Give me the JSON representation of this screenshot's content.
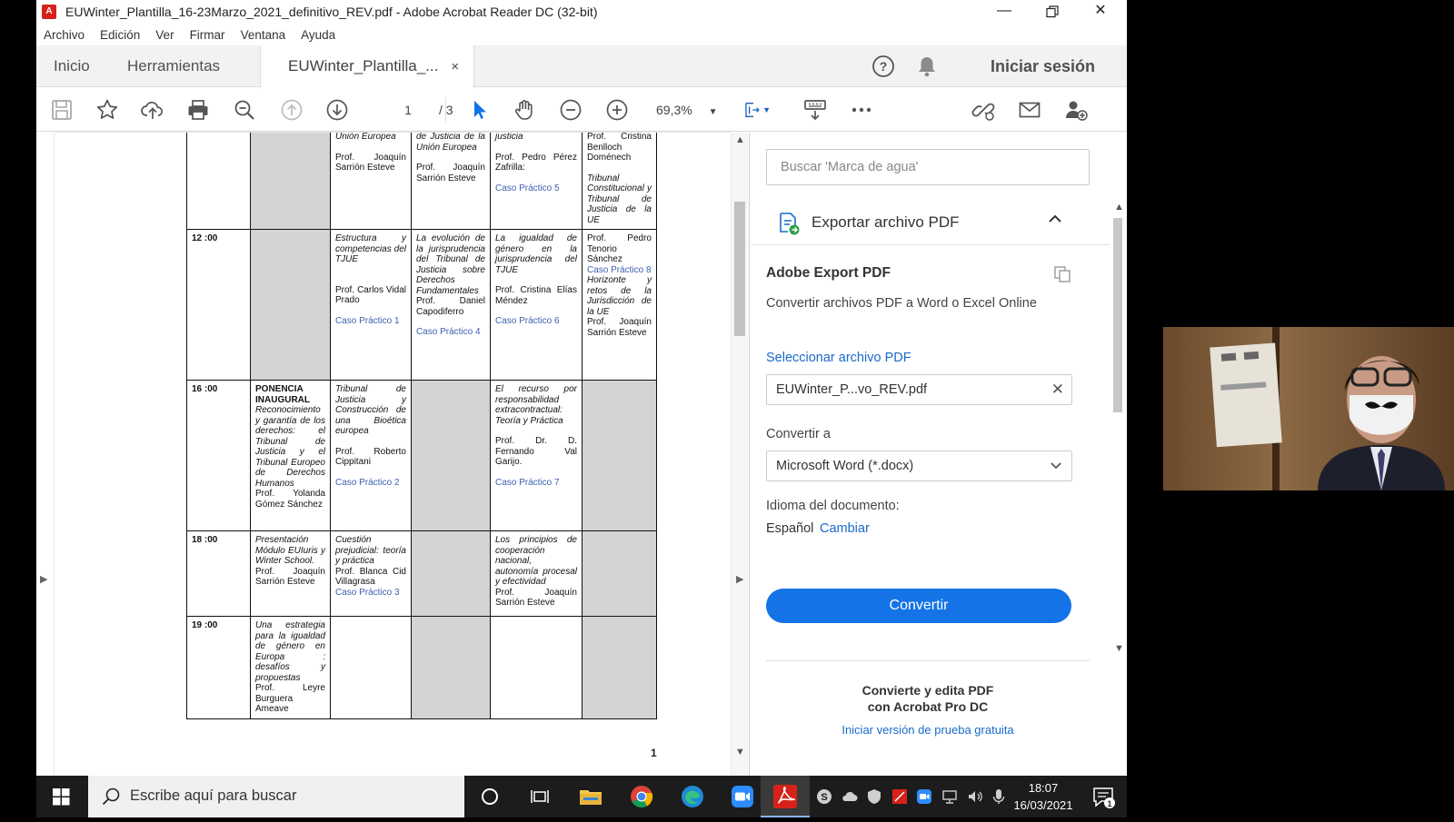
{
  "window": {
    "title": "EUWinter_Plantilla_16-23Marzo_2021_definitivo_REV.pdf - Adobe Acrobat Reader DC (32-bit)",
    "app_icon": "acrobat-icon",
    "controls": [
      "minimize-icon",
      "restore-icon",
      "close-icon"
    ]
  },
  "menu": [
    "Archivo",
    "Edición",
    "Ver",
    "Firmar",
    "Ventana",
    "Ayuda"
  ],
  "tabs": {
    "home": "Inicio",
    "tools": "Herramientas",
    "document": "EUWinter_Plantilla_...",
    "close": "×"
  },
  "header": {
    "sign_in": "Iniciar sesión",
    "help": "?"
  },
  "toolbar": {
    "page_current": "1",
    "page_total": "/ 3",
    "zoom": "69,3%"
  },
  "schedule": {
    "rows": [
      {
        "time": "",
        "cells": [
          {
            "gray": true,
            "lines": []
          },
          {
            "lines": [
              {
                "t": "Unión Europea",
                "s": "i"
              },
              {
                "t": "",
                "s": "i"
              },
              {
                "t": "Prof. Joaquín Sarrión Esteve",
                "s": "p"
              }
            ]
          },
          {
            "lines": [
              {
                "t": "de Justicia de la Unión Europea",
                "s": "i"
              },
              {
                "t": "",
                "s": "i"
              },
              {
                "t": "Prof. Joaquín Sarrión Esteve",
                "s": "p"
              }
            ]
          },
          {
            "lines": [
              {
                "t": "justicia",
                "s": "i"
              },
              {
                "t": "",
                "s": "i"
              },
              {
                "t": "Prof. Pedro Pérez Zafrilla:",
                "s": "p"
              },
              {
                "t": "",
                "s": "i"
              },
              {
                "t": "Caso Práctico 5",
                "s": "c"
              }
            ]
          },
          {
            "lines": [
              {
                "t": "Prof. Cristina Benlloch Doménech",
                "s": "p"
              },
              {
                "t": "",
                "s": "i"
              },
              {
                "t": "Tribunal Constitucional y Tribunal de Justicia de la UE",
                "s": "i"
              }
            ]
          }
        ]
      },
      {
        "time": "12 :00",
        "cells": [
          {
            "gray": true,
            "lines": []
          },
          {
            "lines": [
              {
                "t": "Estructura y competencias del TJUE",
                "s": "i"
              },
              {
                "t": "",
                "s": "i"
              },
              {
                "t": "",
                "s": "i"
              },
              {
                "t": "Prof. Carlos Vidal Prado",
                "s": "p"
              },
              {
                "t": "",
                "s": "i"
              },
              {
                "t": "Caso Práctico 1",
                "s": "c"
              }
            ]
          },
          {
            "lines": [
              {
                "t": "La evolución de la jurisprudencia del Tribunal de Justicia sobre Derechos Fundamentales",
                "s": "i"
              },
              {
                "t": "Prof. Daniel Capodiferro",
                "s": "p"
              },
              {
                "t": "",
                "s": "i"
              },
              {
                "t": "Caso Práctico 4",
                "s": "c"
              }
            ]
          },
          {
            "lines": [
              {
                "t": "La igualdad de género en la jurisprudencia del TJUE",
                "s": "i"
              },
              {
                "t": "",
                "s": "i"
              },
              {
                "t": "Prof. Cristina Elías Méndez",
                "s": "p"
              },
              {
                "t": "",
                "s": "i"
              },
              {
                "t": "Caso Práctico 6",
                "s": "c"
              }
            ]
          },
          {
            "lines": [
              {
                "t": "Prof. Pedro Tenorio Sánchez",
                "s": "p"
              },
              {
                "t": "Caso Práctico 8",
                "s": "c"
              },
              {
                "t": "Horizonte y retos de la Jurisdicción de la UE",
                "s": "i"
              },
              {
                "t": "Prof. Joaquín Sarrión Esteve",
                "s": "p"
              }
            ]
          }
        ]
      },
      {
        "time": "16 :00",
        "cells": [
          {
            "lines": [
              {
                "t": "PONENCIA INAUGURAL",
                "s": "b"
              },
              {
                "t": "Reconocimiento y garantía de los derechos: el Tribunal de Justicia y el Tribunal Europeo de Derechos Humanos",
                "s": "i"
              },
              {
                "t": "Prof. Yolanda Gómez Sánchez",
                "s": "p"
              }
            ]
          },
          {
            "lines": [
              {
                "t": "Tribunal de Justicia y Construcción de una Bioética europea",
                "s": "i"
              },
              {
                "t": "",
                "s": "i"
              },
              {
                "t": "Prof. Roberto Cippitani",
                "s": "p"
              },
              {
                "t": "",
                "s": "i"
              },
              {
                "t": "Caso Práctico 2",
                "s": "c"
              }
            ]
          },
          {
            "gray": true,
            "lines": []
          },
          {
            "lines": [
              {
                "t": "El recurso por responsabilidad extracontractual: Teoría y Práctica",
                "s": "i"
              },
              {
                "t": "",
                "s": "i"
              },
              {
                "t": "Prof. Dr. D. Fernando Val Garijo.",
                "s": "p"
              },
              {
                "t": "",
                "s": "i"
              },
              {
                "t": "Caso Práctico 7",
                "s": "c"
              }
            ]
          },
          {
            "gray": true,
            "lines": []
          }
        ]
      },
      {
        "time": "18 :00",
        "cells": [
          {
            "lines": [
              {
                "t": "Presentación Módulo EUIuris y Winter School.",
                "s": "i"
              },
              {
                "t": "Prof. Joaquín Sarrión Esteve",
                "s": "p"
              }
            ]
          },
          {
            "lines": [
              {
                "t": "Cuestión prejudicial: teoría y práctica",
                "s": "i"
              },
              {
                "t": "Prof. Blanca Cid Villagrasa",
                "s": "p"
              },
              {
                "t": "Caso Práctico 3",
                "s": "c"
              }
            ]
          },
          {
            "gray": true,
            "lines": []
          },
          {
            "lines": [
              {
                "t": "Los principios de cooperación nacional, autonomía procesal y efectividad",
                "s": "i"
              },
              {
                "t": "Prof. Joaquín Sarrión Esteve",
                "s": "p"
              }
            ]
          },
          {
            "gray": true,
            "lines": []
          }
        ]
      },
      {
        "time": "19 :00",
        "cells": [
          {
            "lines": [
              {
                "t": "Una estrategia para la igualdad de género en Europa : desafíos y propuestas",
                "s": "i"
              },
              {
                "t": "Prof. Leyre Burguera Ameave",
                "s": "p"
              }
            ]
          },
          {
            "lines": []
          },
          {
            "gray": true,
            "lines": []
          },
          {
            "lines": []
          },
          {
            "gray": true,
            "lines": []
          }
        ]
      }
    ],
    "page_number": "1"
  },
  "panel": {
    "search_placeholder": "Buscar 'Marca de agua'",
    "export_header": "Exportar archivo PDF",
    "aep_title": "Adobe Export PDF",
    "aep_desc": "Convertir archivos PDF a Word o Excel Online",
    "select_link": "Seleccionar archivo PDF",
    "file_name": "EUWinter_P...vo_REV.pdf",
    "convert_to_label": "Convertir a",
    "format": "Microsoft Word (*.docx)",
    "doc_lang_label": "Idioma del documento:",
    "doc_lang": "Español",
    "change": "Cambiar",
    "convert_button": "Convertir",
    "promo_line1": "Convierte y edita PDF",
    "promo_line2": "con Acrobat Pro DC",
    "trial_link": "Iniciar versión de prueba gratuita"
  },
  "taskbar": {
    "search_text": "Escribe aquí para buscar",
    "time": "18:07",
    "date": "16/03/2021",
    "notifications": "1"
  },
  "colors": {
    "accent": "#1473e6",
    "link": "#1a6acb",
    "acrobat_red": "#d6221b",
    "case_blue": "#3c5fb0"
  }
}
